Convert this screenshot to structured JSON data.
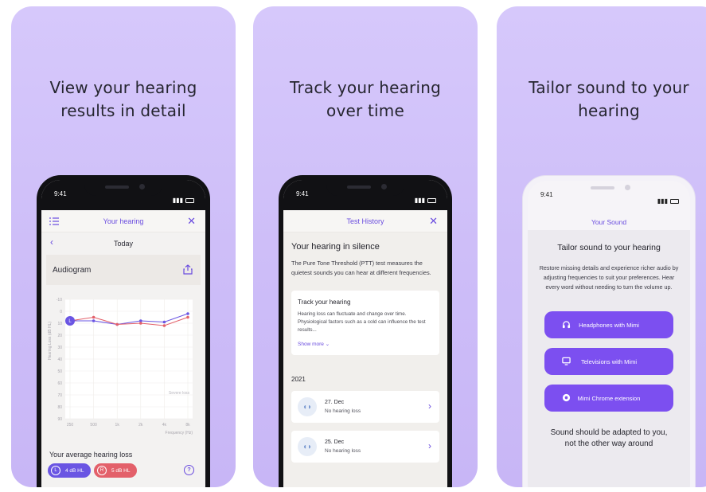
{
  "panels": [
    {
      "headline": "View your hearing\nresults in detail",
      "time": "9:41",
      "topbar_title": "Your hearing",
      "date_nav": "Today",
      "card_title": "Audiogram",
      "y_axis_label": "Hearing Loss (dB HL)",
      "x_axis_label": "Frequency (Hz)",
      "severe_label": "Severe loss",
      "x_ticks": [
        "250",
        "500",
        "1k",
        "2k",
        "4k",
        "8k"
      ],
      "y_ticks": [
        "-10",
        "0",
        "10",
        "20",
        "30",
        "40",
        "50",
        "60",
        "70",
        "80",
        "90"
      ],
      "avg_title": "Your average hearing loss",
      "left_pill": "4 dB HL",
      "left_pill_letter": "L",
      "right_pill": "5 dB HL",
      "right_pill_letter": "R",
      "help_glyph": "?"
    },
    {
      "headline": "Track your hearing\nover time",
      "time": "9:41",
      "topbar_title": "Test History",
      "section_title": "Your hearing in silence",
      "section_body": "The Pure Tone Threshold (PTT) test measures the quietest sounds you can hear at different frequencies.",
      "card_title": "Track your hearing",
      "card_body": "Hearing loss can fluctuate and change over time. Physiological factors such as a cold can influence the test results...",
      "show_more": "Show more",
      "year": "2021",
      "entries": [
        {
          "date": "27. Dec",
          "status": "No hearing loss"
        },
        {
          "date": "25. Dec",
          "status": "No hearing loss"
        }
      ]
    },
    {
      "headline": "Tailor sound to your\nhearing",
      "time": "9:41",
      "topbar_title": "Your Sound",
      "title": "Tailor sound to your hearing",
      "description": "Restore missing details and experience richer audio by adjusting frequencies to suit your preferences. Hear every word without needing to turn the volume up.",
      "buttons": [
        "Headphones with Mimi",
        "Televisions with Mimi",
        "Mimi Chrome extension"
      ],
      "footer": "Sound should be adapted to you,\nnot the other way around"
    }
  ],
  "colors": {
    "accent": "#6a4cdf",
    "left_ear": "#6a55e3",
    "right_ear": "#e3606a",
    "button": "#7c4ff0"
  },
  "chart_data": {
    "type": "line",
    "categories": [
      "250",
      "500",
      "1k",
      "2k",
      "4k",
      "8k"
    ],
    "series": [
      {
        "name": "L",
        "values": [
          8,
          8,
          11,
          8,
          9,
          2
        ]
      },
      {
        "name": "R",
        "values": [
          8,
          5,
          11,
          10,
          12,
          5
        ]
      }
    ],
    "xlabel": "Frequency (Hz)",
    "ylabel": "Hearing Loss (dB HL)",
    "ylim": [
      -10,
      90
    ]
  }
}
